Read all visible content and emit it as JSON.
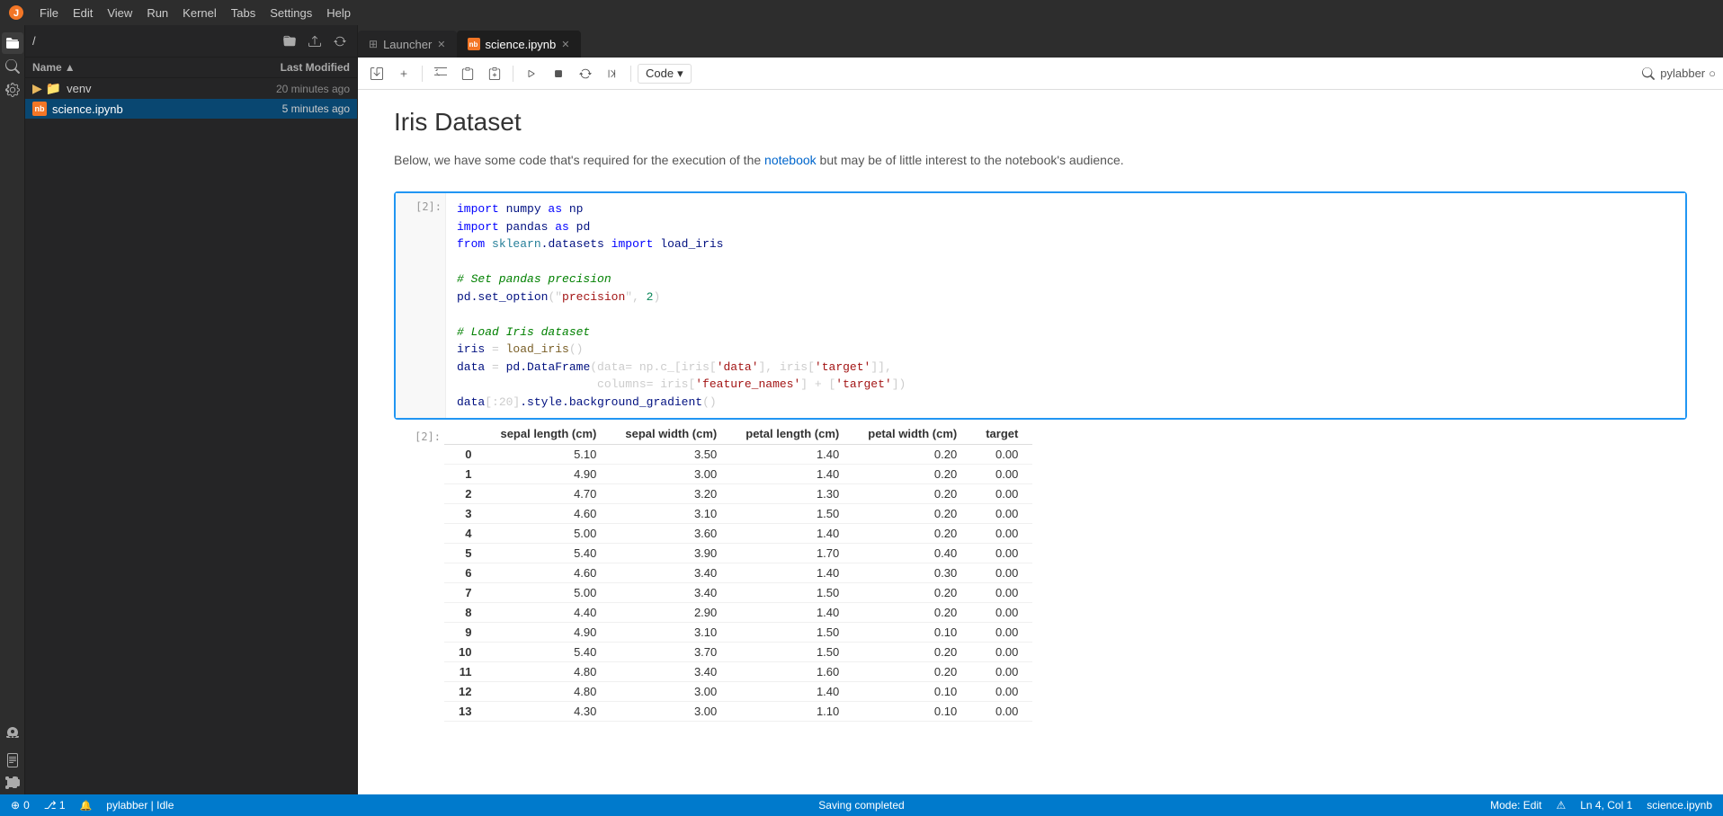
{
  "menubar": {
    "items": [
      "File",
      "Edit",
      "View",
      "Run",
      "Kernel",
      "Tabs",
      "Settings",
      "Help"
    ]
  },
  "sidebar_icons": [
    {
      "name": "folder-icon",
      "symbol": "📁"
    },
    {
      "name": "search-icon",
      "symbol": "🔍"
    },
    {
      "name": "extensions-icon",
      "symbol": "🔧"
    },
    {
      "name": "git-icon",
      "symbol": "⎇"
    },
    {
      "name": "pages-icon",
      "symbol": "📄"
    },
    {
      "name": "puzzle-icon",
      "symbol": "🧩"
    }
  ],
  "file_panel": {
    "path": "/",
    "toolbar_buttons": [
      {
        "name": "new-folder",
        "symbol": "📁"
      },
      {
        "name": "upload",
        "symbol": "⬆"
      },
      {
        "name": "refresh",
        "symbol": "↻"
      }
    ],
    "columns": {
      "name": "Name",
      "last_modified": "Last Modified"
    },
    "files": [
      {
        "name": "venv",
        "type": "folder",
        "modified": "20 minutes ago"
      },
      {
        "name": "science.ipynb",
        "type": "notebook",
        "modified": "5 minutes ago",
        "selected": true
      }
    ]
  },
  "tabs": [
    {
      "label": "Launcher",
      "type": "launcher",
      "active": false,
      "closeable": true
    },
    {
      "label": "science.ipynb",
      "type": "notebook",
      "active": true,
      "closeable": true
    }
  ],
  "toolbar": {
    "save_label": "💾",
    "add_cell": "+",
    "cut": "✂",
    "copy": "⎘",
    "paste": "⊞",
    "run": "▶",
    "stop": "■",
    "restart": "↺",
    "fast_forward": "⏭",
    "cell_type": "Code",
    "kernel_name": "pylabber",
    "kernel_indicator": "○"
  },
  "notebook": {
    "title": "Iris Dataset",
    "subtitle": "Below, we have some code that's required for the execution of the notebook but may be of little interest to the notebook's audience.",
    "subtitle_highlight": "notebook",
    "cell_in_label": "[2]:",
    "cell_out_label": "[2]:",
    "code_lines": [
      {
        "tokens": [
          {
            "t": "kw",
            "v": "import"
          },
          {
            "t": "var",
            "v": " numpy "
          },
          {
            "t": "kw",
            "v": "as"
          },
          {
            "t": "var",
            "v": " np"
          }
        ]
      },
      {
        "tokens": [
          {
            "t": "kw",
            "v": "import"
          },
          {
            "t": "var",
            "v": " pandas "
          },
          {
            "t": "kw",
            "v": "as"
          },
          {
            "t": "var",
            "v": " pd"
          }
        ]
      },
      {
        "tokens": [
          {
            "t": "kw",
            "v": "from"
          },
          {
            "t": "mod",
            "v": " sklearn"
          },
          {
            "t": "attr",
            "v": ".datasets"
          },
          {
            "t": "kw",
            "v": " import"
          },
          {
            "t": "var",
            "v": " load_iris"
          }
        ]
      },
      {
        "tokens": [
          {
            "t": "plain",
            "v": ""
          }
        ]
      },
      {
        "tokens": [
          {
            "t": "comment",
            "v": "# Set pandas precision"
          }
        ]
      },
      {
        "tokens": [
          {
            "t": "var",
            "v": "pd"
          },
          {
            "t": "attr",
            "v": ".set_option"
          },
          {
            "t": "plain",
            "v": "("
          },
          {
            "t": "str",
            "v": "\"precision\""
          },
          {
            "t": "plain",
            "v": ", "
          },
          {
            "t": "num",
            "v": "2"
          },
          {
            "t": "plain",
            "v": ")"
          }
        ]
      },
      {
        "tokens": [
          {
            "t": "plain",
            "v": ""
          }
        ]
      },
      {
        "tokens": [
          {
            "t": "comment",
            "v": "# Load Iris dataset"
          }
        ]
      },
      {
        "tokens": [
          {
            "t": "var",
            "v": "iris"
          },
          {
            "t": "plain",
            "v": " = "
          },
          {
            "t": "fn",
            "v": "load_iris"
          },
          {
            "t": "plain",
            "v": "()"
          }
        ]
      },
      {
        "tokens": [
          {
            "t": "var",
            "v": "data"
          },
          {
            "t": "plain",
            "v": " = "
          },
          {
            "t": "var",
            "v": "pd"
          },
          {
            "t": "attr",
            "v": ".DataFrame"
          },
          {
            "t": "plain",
            "v": "(data= np.c_[iris["
          },
          {
            "t": "str",
            "v": "'data'"
          },
          {
            "t": "plain",
            "v": "], iris["
          },
          {
            "t": "str",
            "v": "'target'"
          },
          {
            "t": "plain",
            "v": "]],"
          }
        ]
      },
      {
        "tokens": [
          {
            "t": "plain",
            "v": "                    columns= iris["
          },
          {
            "t": "str",
            "v": "'feature_names'"
          },
          {
            "t": "plain",
            "v": "] + ["
          },
          {
            "t": "str",
            "v": "'target'"
          },
          {
            "t": "plain",
            "v": "])"
          }
        ]
      },
      {
        "tokens": [
          {
            "t": "var",
            "v": "data"
          },
          {
            "t": "plain",
            "v": "[:20]"
          },
          {
            "t": "attr",
            "v": ".style"
          },
          {
            "t": "attr",
            "v": ".background_gradient"
          },
          {
            "t": "plain",
            "v": "()"
          }
        ]
      }
    ],
    "df_headers": [
      "",
      "sepal length (cm)",
      "sepal width (cm)",
      "petal length (cm)",
      "petal width (cm)",
      "target"
    ],
    "df_rows": [
      [
        0,
        5.1,
        3.5,
        1.4,
        0.2,
        0.0
      ],
      [
        1,
        4.9,
        3.0,
        1.4,
        0.2,
        0.0
      ],
      [
        2,
        4.7,
        3.2,
        1.3,
        0.2,
        0.0
      ],
      [
        3,
        4.6,
        3.1,
        1.5,
        0.2,
        0.0
      ],
      [
        4,
        5.0,
        3.6,
        1.4,
        0.2,
        0.0
      ],
      [
        5,
        5.4,
        3.9,
        1.7,
        0.4,
        0.0
      ],
      [
        6,
        4.6,
        3.4,
        1.4,
        0.3,
        0.0
      ],
      [
        7,
        5.0,
        3.4,
        1.5,
        0.2,
        0.0
      ],
      [
        8,
        4.4,
        2.9,
        1.4,
        0.2,
        0.0
      ],
      [
        9,
        4.9,
        3.1,
        1.5,
        0.1,
        0.0
      ],
      [
        10,
        5.4,
        3.7,
        1.5,
        0.2,
        0.0
      ],
      [
        11,
        4.8,
        3.4,
        1.6,
        0.2,
        0.0
      ],
      [
        12,
        4.8,
        3.0,
        1.4,
        0.1,
        0.0
      ],
      [
        13,
        4.3,
        3.0,
        1.1,
        0.1,
        0.0
      ]
    ]
  },
  "statusbar": {
    "left": "0",
    "git": "⎇ 1",
    "bell": "🔔",
    "kernel": "pylabber | Idle",
    "center": "Saving completed",
    "mode": "Mode: Edit",
    "error_icon": "⚠",
    "ln_col": "Ln 4, Col 1",
    "filename": "science.ipynb"
  }
}
